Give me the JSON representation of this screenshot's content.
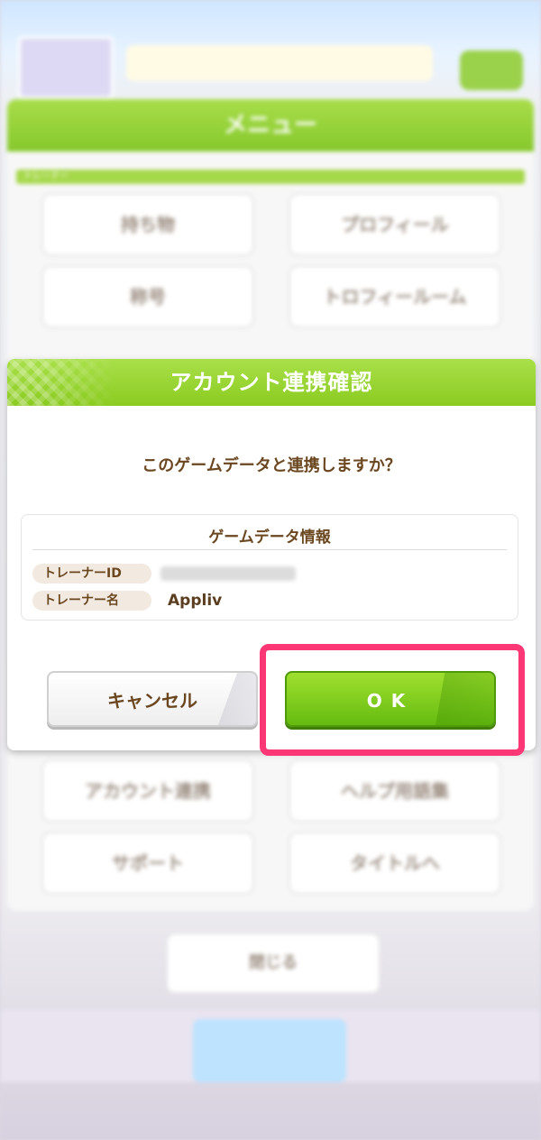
{
  "background": {
    "menu_title": "メニュー",
    "section_label": "トレーナー",
    "tiles": [
      "持ち物",
      "プロフィール",
      "称号",
      "トロフィールーム",
      "アカウント連携",
      "ヘルプ用語集",
      "サポート",
      "タイトルへ"
    ],
    "close_label": "閉じる"
  },
  "dialog": {
    "title": "アカウント連携確認",
    "question": "このゲームデータと連携しますか？",
    "info": {
      "title": "ゲームデータ情報",
      "rows": [
        {
          "label": "トレーナーID",
          "value": ""
        },
        {
          "label": "トレーナー名",
          "value": "Appliv"
        }
      ]
    },
    "cancel_label": "キャンセル",
    "ok_label": "OK"
  },
  "colors": {
    "header_green": "#8bcb20",
    "ok_green": "#66bb10",
    "text_brown": "#6b4720",
    "highlight": "#fc3776"
  }
}
